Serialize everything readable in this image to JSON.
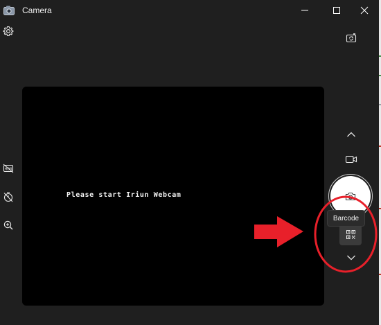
{
  "window": {
    "title": "Camera",
    "controls": [
      "minimize",
      "maximize",
      "close"
    ]
  },
  "preview": {
    "message": "Please start Iriun Webcam"
  },
  "left_tools": [
    "settings-icon",
    "hdr-off-icon",
    "timer-off-icon",
    "zoom-icon"
  ],
  "right_tools": [
    "switch-camera-icon",
    "chevron-up-icon",
    "video-mode-icon",
    "photo-shutter-icon",
    "barcode-icon",
    "chevron-down-icon"
  ],
  "tooltip": {
    "label": "Barcode"
  },
  "annotation": {
    "arrow_color": "#e8202a",
    "circle_color": "#e8202a"
  },
  "colors": {
    "window_bg": "#1f1f1f",
    "preview_bg": "#000000",
    "shutter": "#ffffff",
    "highlight": "#e8202a"
  }
}
